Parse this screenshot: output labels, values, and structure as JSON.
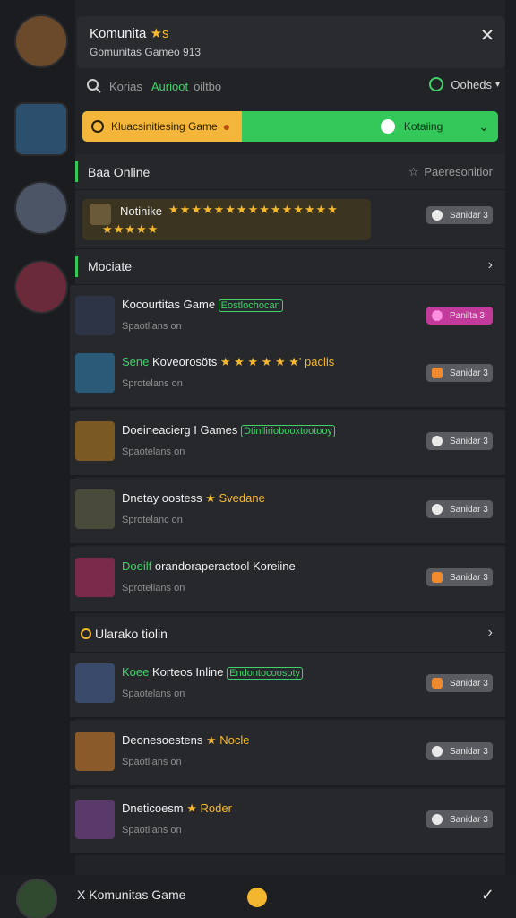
{
  "rail": {
    "avatars": [
      {
        "name": "rail-avatar-1",
        "color": "#6a4a2a"
      },
      {
        "name": "rail-avatar-2",
        "color": "#2d4f6e"
      },
      {
        "name": "rail-avatar-3",
        "color": "#4b5566"
      },
      {
        "name": "rail-avatar-4",
        "color": "#6a2a3a"
      }
    ]
  },
  "header": {
    "title": "Komunita",
    "title_star": "★s",
    "subtitle": "Gomunitas Gamео 913",
    "close_icon": "close-icon"
  },
  "search": {
    "term1": "Korias",
    "term2": "Aurioot",
    "term3": "oiltbo",
    "sort_label": "Ooheds"
  },
  "banner": {
    "left_label": "Kluacsinitiesing Game",
    "right_label": "Kotaiing"
  },
  "section1": {
    "label": "Baa Online",
    "right": "Paeresonitior"
  },
  "featured": {
    "name": "Notinike",
    "stars": "★★★★★★★★★★★★★★★",
    "stars2": "★★★★★"
  },
  "section2": {
    "label": "Mociate"
  },
  "section3": {
    "label": "Ularako tiolin"
  },
  "rows": [
    {
      "title": "Kocourtitas Game",
      "tag": "Eostlochocan",
      "sub": "Spaotlians on",
      "badge": "Panilta 3",
      "style": "pink",
      "thumb": "#2d3446"
    },
    {
      "title_green": "Sene",
      "title": "Koveorosöts",
      "stars": "★ ★ ★ ★ ★ ★'",
      "after": "paclis",
      "sub": "Sprotelans on",
      "badge": "Sanidar 3",
      "style": "orange",
      "thumb": "#2a5a78"
    },
    {
      "title": "Doeineacierg I Games",
      "tag": "Dtinlliriobooxtootooy",
      "sub": "Spaotelans on",
      "badge": "Sanidar 3",
      "style": "gray",
      "thumb": "#7a5a22"
    },
    {
      "title": "Dnetay oostess",
      "star": "★",
      "after": "Svedane",
      "sub": "Sprotelanc on",
      "badge": "Sanidar 3",
      "style": "gray",
      "thumb": "#4a4a3a"
    },
    {
      "title_green": "Doeilf",
      "title": "orandoraperactool Koreiine",
      "sub": "Sprotelians on",
      "badge": "Sanidar 3",
      "style": "orange",
      "thumb": "#7a2a4a"
    },
    {
      "title_green": "Koee",
      "title": "Korteos Inline",
      "tag": "Endontocoosoty",
      "sub": "Spaotelans on",
      "badge": "Sanidar 3",
      "style": "orange",
      "thumb": "#3a4a6a"
    },
    {
      "title": "Deonesoestens",
      "star": "★",
      "after": "Nocle",
      "sub": "Spaotlians on",
      "badge": "Sanidar 3",
      "style": "gray",
      "thumb": "#8a5a2a"
    },
    {
      "title": "Dneticoesm",
      "star": "★",
      "after": "Roder",
      "sub": "Spaotlians on",
      "badge": "Sanidar 3",
      "style": "gray",
      "thumb": "#5a3a6a"
    }
  ],
  "footer": {
    "label": "X Komunitas Game"
  }
}
